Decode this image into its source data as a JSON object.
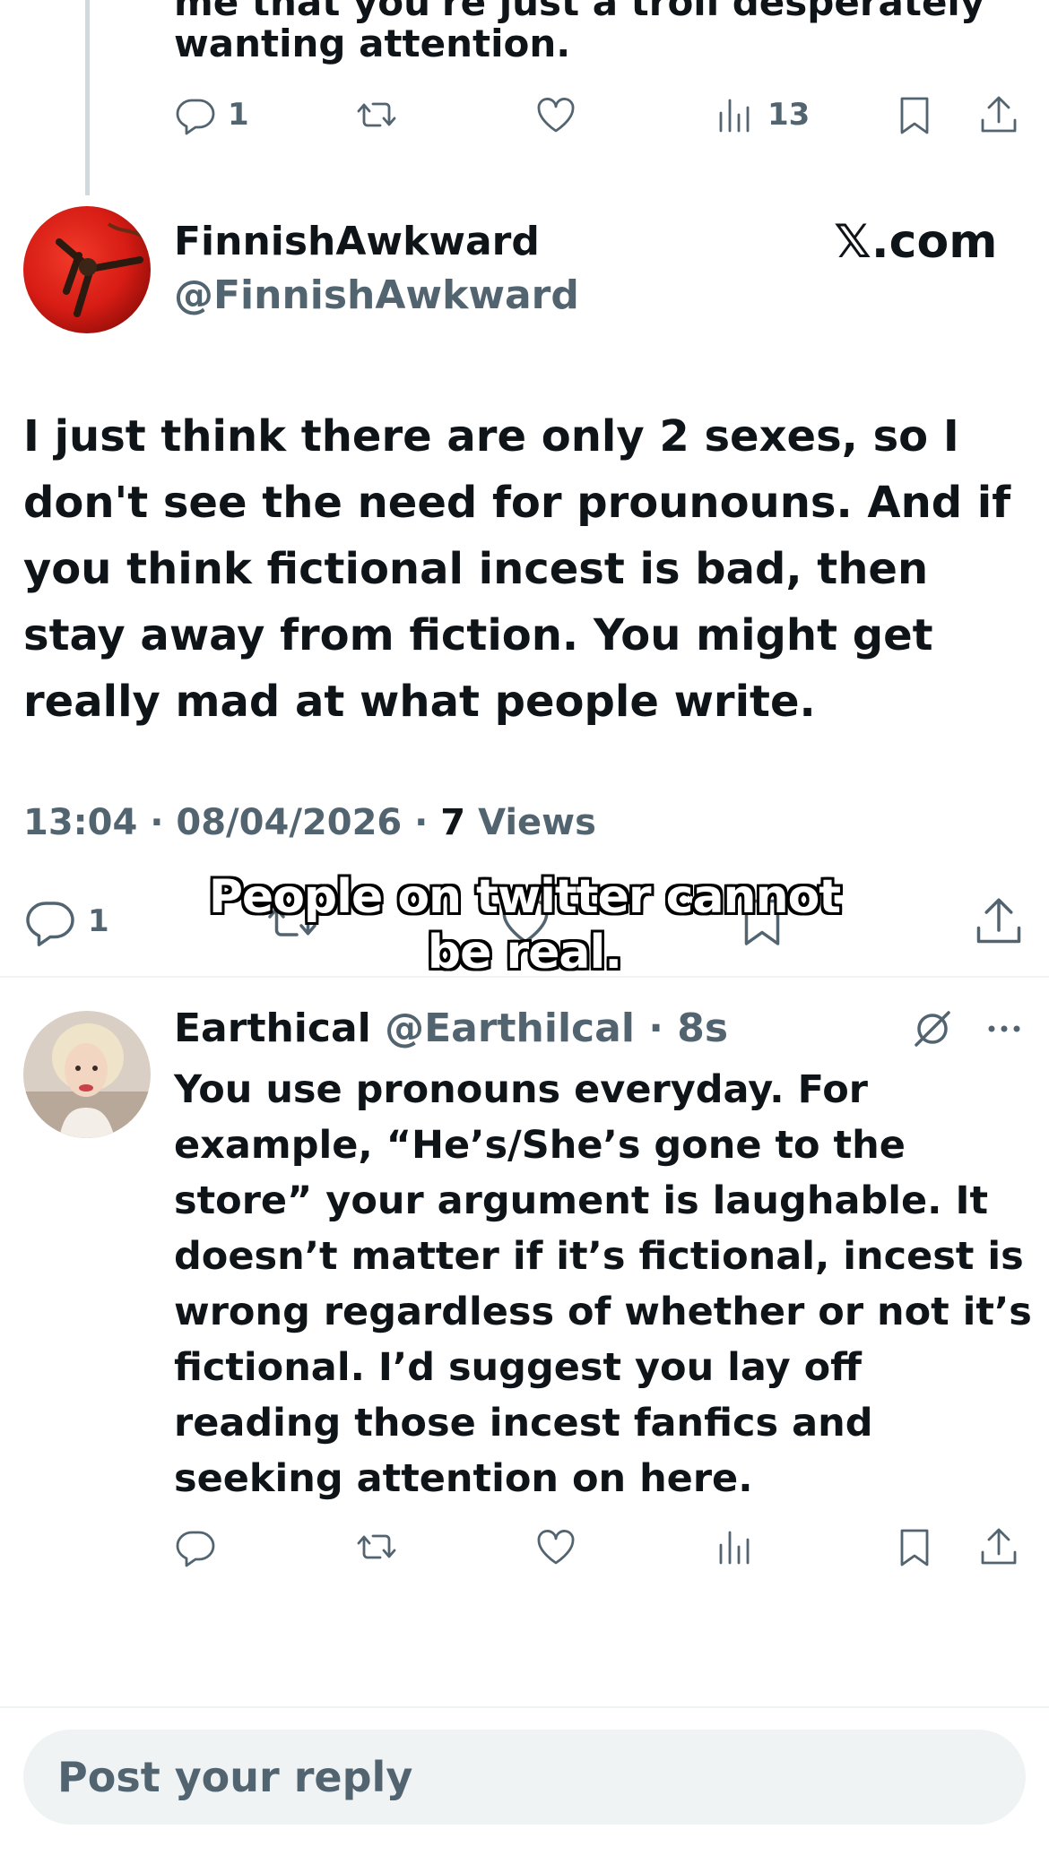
{
  "previous_tweet": {
    "cut_text": "me that you're just a troll desperately",
    "text": "wanting attention.",
    "reply_count": "1",
    "views": "13"
  },
  "main_tweet": {
    "display_name": "FinnishAwkward",
    "handle": "@FinnishAwkward",
    "watermark": "𝕏.com",
    "text": "I just think there are only 2 sexes, so I don't see the need for prounouns. And if you think fictional incest is bad, then stay away from fiction. You might get really mad at what people write.",
    "time": "13:04",
    "date": "08/04/2026",
    "views_count": "7",
    "views_label": "Views",
    "reply_count": "1"
  },
  "caption": "People on twitter cannot be real.",
  "reply": {
    "display_name": "Earthical",
    "handle": "@Earthilcal",
    "age": "8s",
    "text": "You use pronouns everyday. For example, “He’s/She’s gone to the store” your argument is laughable. It doesn’t matter if it’s fictional, incest is wrong regardless of whether or not it’s fictional. I’d suggest you lay off reading those incest fanfics and seeking attention on here."
  },
  "composer": {
    "placeholder": "Post your reply"
  },
  "colors": {
    "text": "#0f1419",
    "secondary": "#536471",
    "divider": "#eff3f4",
    "thread_line": "#cfd9de"
  }
}
